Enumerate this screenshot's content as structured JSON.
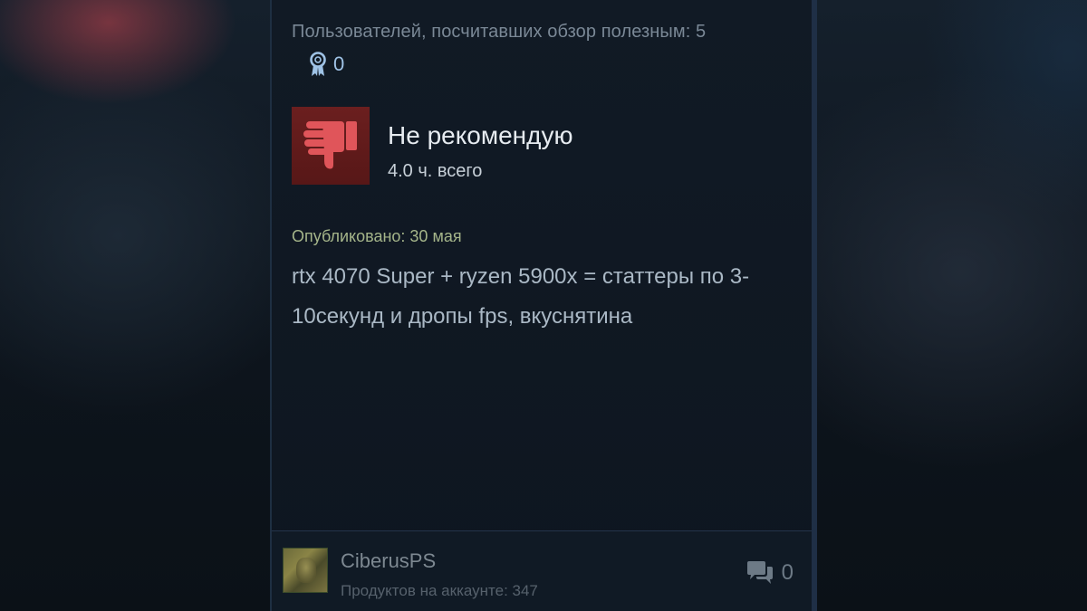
{
  "review": {
    "helpful_text": "Пользователей, посчитавших обзор полезным: 5",
    "award_count": "0",
    "verdict": "Не рекомендую",
    "hours": "4.0 ч. всего",
    "published": "Опубликовано: 30 мая",
    "text": "rtx 4070 Super + ryzen 5900x = статтеры по 3-10секунд и дропы fps, вкуснятина"
  },
  "author": {
    "name": "CiberusPS",
    "products": "Продуктов на аккаунте: 347"
  },
  "comments": {
    "count": "0"
  },
  "icons": {
    "award": "award-ribbon-icon",
    "verdict": "thumbs-down-icon",
    "comments": "comment-bubbles-icon"
  },
  "colors": {
    "negative": "#d9484a",
    "award": "#9fc3e6",
    "published": "#a5b58a"
  }
}
